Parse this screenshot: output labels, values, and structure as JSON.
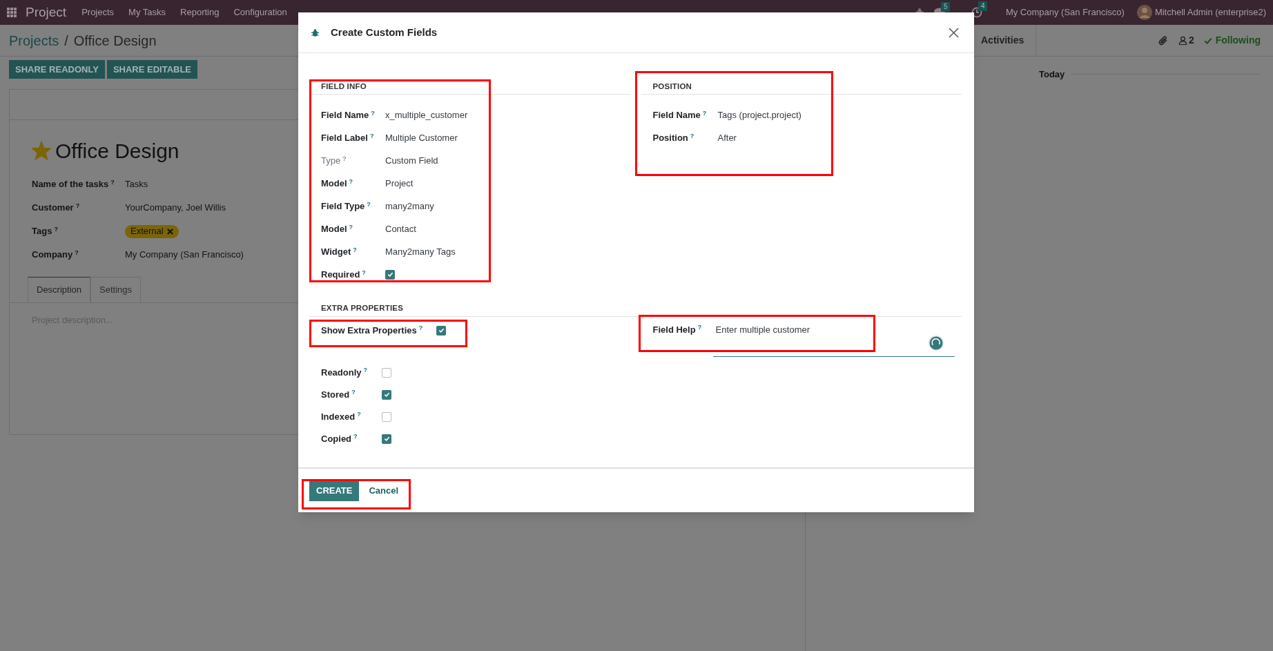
{
  "navbar": {
    "app_name": "Project",
    "menu": [
      "Projects",
      "My Tasks",
      "Reporting",
      "Configuration"
    ],
    "chat_count": "5",
    "activity_count": "4",
    "company": "My Company (San Francisco)",
    "user": "Mitchell Admin (enterprise2)"
  },
  "breadcrumb": {
    "parent": "Projects",
    "separator": "/",
    "current": "Office Design"
  },
  "actions": [
    "SHARE READONLY",
    "SHARE EDITABLE"
  ],
  "record": {
    "title": "Office Design",
    "starred": true,
    "fields": [
      {
        "kind": "text",
        "label": "Name of the tasks$^{?}$",
        "value": "Tasks"
      },
      {
        "kind": "text",
        "label": "Customer$^{?}$",
        "value": "YourCompany, Joel Willis"
      },
      {
        "kind": "tag",
        "label": "Tags$^{?}$",
        "value": "External"
      },
      {
        "kind": "text",
        "label": "Company$^{?}$",
        "value": "My Company (San Francisco)"
      }
    ],
    "tabs": [
      {
        "label": "Description",
        "selected": true
      },
      {
        "label": "Settings",
        "selected": false
      }
    ],
    "description_placeholder": "Project description..."
  },
  "chatter": {
    "activities": "Activities",
    "followers": "2",
    "following": "Following",
    "date_separator": "Today"
  },
  "dialog": {
    "title": "Create Custom Fields",
    "field_info": {
      "heading": "FIELD INFO",
      "highlighted": true,
      "rows": [
        {
          "kind": "text",
          "label": "Field Name$^{?}$",
          "value": "x_multiple_customer",
          "muted": false
        },
        {
          "kind": "text",
          "label": "Field Label$^{?}$",
          "value": "Multiple Customer",
          "muted": false
        },
        {
          "kind": "text",
          "label": "Type$^{?}$",
          "value": "Custom Field",
          "muted": true
        },
        {
          "kind": "text",
          "label": "Model$^{?}$",
          "value": "Project",
          "muted": false
        },
        {
          "kind": "text",
          "label": "Field Type$^{?}$",
          "value": "many2many",
          "muted": false
        },
        {
          "kind": "text",
          "label": "Model$^{?}$",
          "value": "Contact",
          "muted": false
        },
        {
          "kind": "text",
          "label": "Widget$^{?}$",
          "value": "Many2many Tags",
          "muted": false
        },
        {
          "kind": "checkbox",
          "label": "Required$^{?}$",
          "checked": true,
          "muted": false
        }
      ]
    },
    "position": {
      "heading": "POSITION",
      "highlighted": true,
      "rows": [
        {
          "label": "Field Name$^{?}$",
          "value": "Tags (project.project)"
        },
        {
          "label": "Position$^{?}$",
          "value": "After"
        }
      ]
    },
    "extra": {
      "heading": "EXTRA PROPERTIES",
      "show_extra": {
        "label": "Show Extra Properties$^{?}$",
        "checked": true,
        "highlighted": true
      },
      "field_help": {
        "label": "Field Help$^{?}$",
        "value": "Enter multiple customer",
        "highlighted": true
      },
      "flags": [
        {
          "label": "Readonly$^{?}$",
          "checked": false
        },
        {
          "label": "Stored$^{?}$",
          "checked": true
        },
        {
          "label": "Indexed$^{?}$",
          "checked": false
        },
        {
          "label": "Copied$^{?}$",
          "checked": true
        }
      ]
    },
    "buttons": {
      "primary": "CREATE",
      "secondary": "Cancel",
      "highlighted": true
    }
  }
}
